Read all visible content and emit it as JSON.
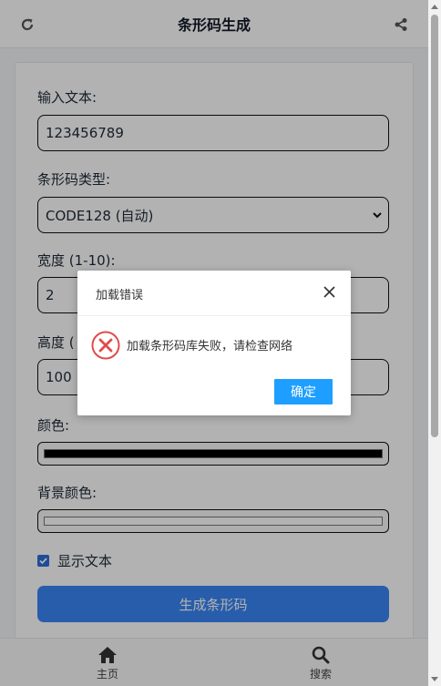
{
  "header": {
    "title": "条形码生成",
    "refresh_icon": "refresh-icon",
    "share_icon": "share-icon"
  },
  "form": {
    "input_label": "输入文本:",
    "input_value": "123456789",
    "type_label": "条形码类型:",
    "type_value": "CODE128 (自动)",
    "width_label": "宽度 (1-10):",
    "width_value": "2",
    "height_label": "高度 (",
    "height_value": "100",
    "color_label": "颜色:",
    "color_value": "#000000",
    "bg_color_label": "背景颜色:",
    "bg_color_value": "#ffffff",
    "show_text_label": "显示文本",
    "show_text_checked": true,
    "generate_label": "生成条形码"
  },
  "bottom_nav": [
    {
      "label": "主页",
      "icon": "home-icon"
    },
    {
      "label": "搜索",
      "icon": "search-icon"
    }
  ],
  "dialog": {
    "title": "加载错误",
    "message": "加载条形码库失败，请检查网络",
    "ok_label": "确定",
    "icon": "error-circle-icon"
  },
  "colors": {
    "primary": "#3a86f5",
    "dialog_button": "#1e9fff",
    "error": "#e04c4c"
  }
}
